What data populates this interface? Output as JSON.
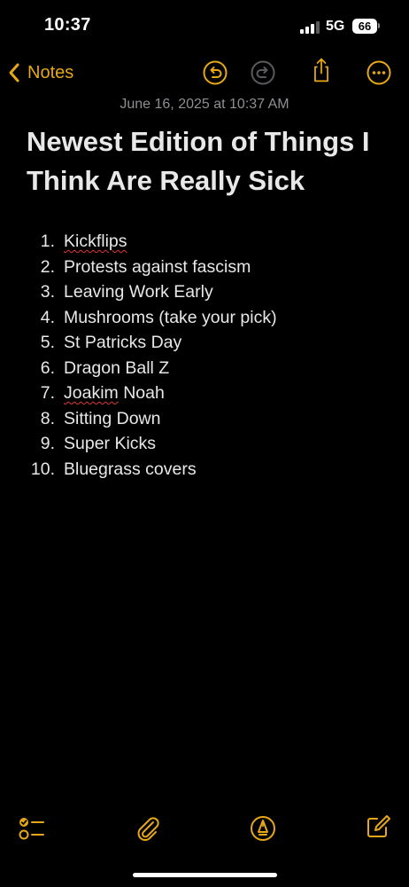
{
  "status_bar": {
    "time": "10:37",
    "network": "5G",
    "battery": "66"
  },
  "nav": {
    "back_label": "Notes"
  },
  "note": {
    "timestamp": "June 16, 2025 at 10:37 AM",
    "title": "Newest Edition of Things I Think Are Really Sick",
    "items": [
      {
        "num": "1.",
        "text": "Kickflips"
      },
      {
        "num": "2.",
        "text": "Protests against fascism"
      },
      {
        "num": "3.",
        "text": "Leaving Work Early"
      },
      {
        "num": "4.",
        "text": "Mushrooms (take your pick)"
      },
      {
        "num": "5.",
        "text": "St Patricks Day"
      },
      {
        "num": "6.",
        "text": "Dragon Ball Z"
      },
      {
        "num": "7.",
        "text": "Joakim",
        "text_rest": " Noah"
      },
      {
        "num": "8.",
        "text": "Sitting Down"
      },
      {
        "num": "9.",
        "text": "Super Kicks"
      },
      {
        "num": "10.",
        "text": "Bluegrass covers"
      }
    ]
  },
  "icons": {
    "undo": "undo-icon",
    "redo": "redo-icon",
    "share": "share-icon",
    "more": "more-icon",
    "checklist": "checklist-icon",
    "attach": "paperclip-icon",
    "markup": "markup-pen-icon",
    "compose": "compose-icon"
  },
  "colors": {
    "accent": "#e6a817",
    "background": "#000000",
    "text": "#e8e8e8",
    "secondary_text": "#8e8e93",
    "disabled": "#5a5a5e",
    "spellcheck": "#e03535"
  }
}
